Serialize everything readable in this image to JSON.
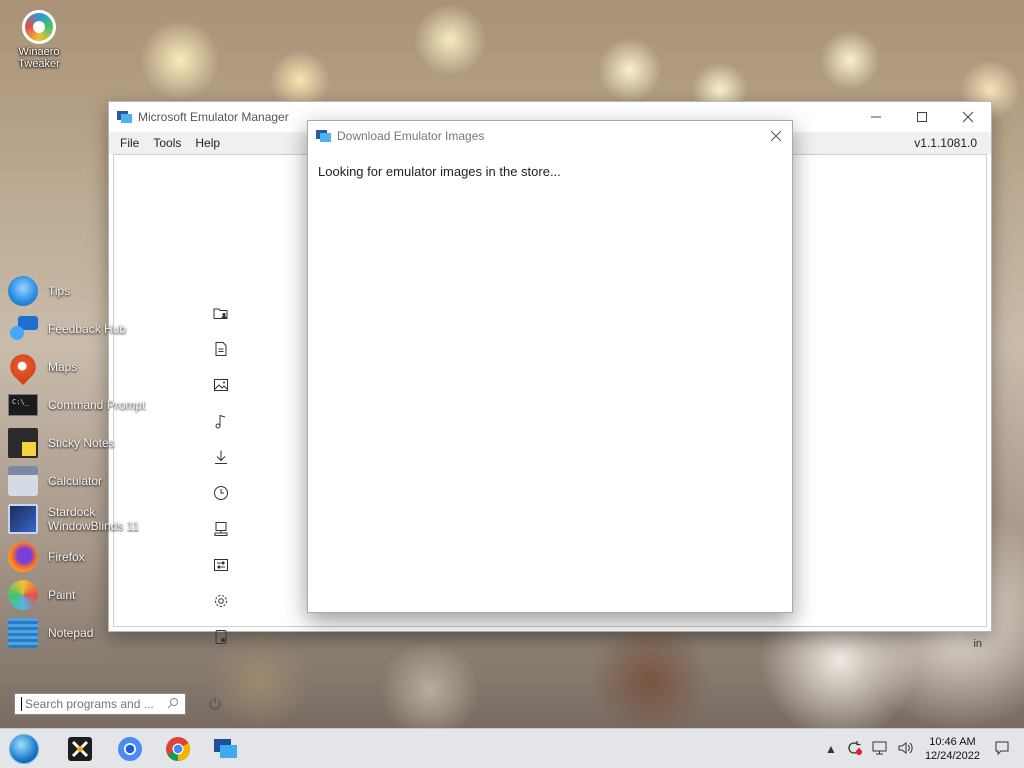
{
  "desktop": {
    "icon_label": "Winaero Tweaker"
  },
  "main_window": {
    "title": "Microsoft Emulator Manager",
    "menu": [
      "File",
      "Tools",
      "Help"
    ],
    "version": "v1.1.1081.0",
    "right_text_fragment": "in",
    "side_icons": [
      "folder-person-icon",
      "document-icon",
      "image-icon",
      "music-icon",
      "download-icon",
      "history-icon",
      "device-icon",
      "settings-sliders-icon",
      "gear-icon",
      "storage-icon"
    ]
  },
  "dialog": {
    "title": "Download Emulator Images",
    "message": "Looking for emulator images in the store..."
  },
  "start_menu": {
    "items": [
      {
        "label": "Tips",
        "icon": "lightbulb-icon",
        "color": "#2d8fe6"
      },
      {
        "label": "Feedback Hub",
        "icon": "feedback-icon",
        "color": "#1f6fd0"
      },
      {
        "label": "Maps",
        "icon": "map-pin-icon",
        "color": "#e8562a"
      },
      {
        "label": "Command Prompt",
        "icon": "terminal-icon",
        "color": "#1b1b1b"
      },
      {
        "label": "Sticky Notes",
        "icon": "sticky-note-icon",
        "color": "#f4d33c"
      },
      {
        "label": "Calculator",
        "icon": "calculator-icon",
        "color": "#5a6a7e"
      },
      {
        "label": "Stardock WindowBlinds 11",
        "icon": "windowblinds-icon",
        "color": "#3b66c9"
      },
      {
        "label": "Firefox",
        "icon": "firefox-icon",
        "color": "#ff7a18"
      },
      {
        "label": "Paint",
        "icon": "paint-icon",
        "color": "#4cb8e8"
      },
      {
        "label": "Notepad",
        "icon": "notepad-icon",
        "color": "#4da3e3"
      }
    ],
    "search_placeholder": "Search programs and ..."
  },
  "taskbar": {
    "pinned": [
      "start-orb-icon",
      "xbox-icon",
      "chromium-icon",
      "chrome-icon",
      "emulator-manager-icon"
    ],
    "clock_time": "10:46 AM",
    "clock_date": "12/24/2022"
  }
}
